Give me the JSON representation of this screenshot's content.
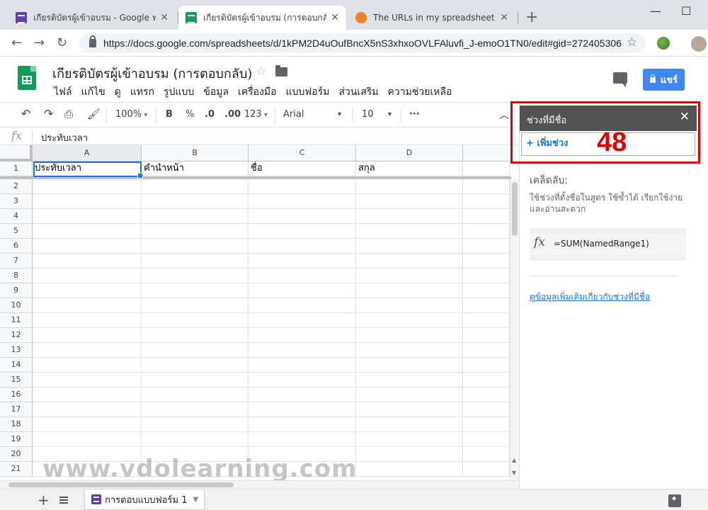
{
  "browser": {
    "tabs": [
      {
        "label": "เกียรติบัตรผู้เข้าอบรม - Google ฟอร์ม",
        "icon": "google-forms-icon",
        "active": false
      },
      {
        "label": "เกียรติบัตรผู้เข้าอบรม (การตอบกลับ) -",
        "icon": "google-sheets-icon",
        "active": true
      },
      {
        "label": "The URLs in my spreadsheet resp",
        "icon": "stackoverflow-icon",
        "active": false
      }
    ],
    "url": "https://docs.google.com/spreadsheets/d/1kPM2D4uOufBncX5nS3xhxoOVLFAluvfi_J-emoO1TN0/edit#gid=272405306"
  },
  "doc": {
    "title": "เกียรติบัตรผู้เข้าอบรม (การตอบกลับ)",
    "menu": [
      "ไฟล์",
      "แก้ไข",
      "ดู",
      "แทรก",
      "รูปแบบ",
      "ข้อมูล",
      "เครื่องมือ",
      "แบบฟอร์ม",
      "ส่วนเสริม",
      "ความช่วยเหลือ"
    ],
    "share_label": "แชร์"
  },
  "toolbar": {
    "zoom": "100%",
    "bold": "B",
    "percent": "%",
    "decrease_decimal": ".0",
    "increase_decimal": ".00",
    "number_format": "123",
    "font": "Arial",
    "font_size": "10",
    "more": "···"
  },
  "formula_bar": {
    "fx": "fx",
    "content": "ประทับเวลา"
  },
  "grid": {
    "columns": [
      "A",
      "B",
      "C",
      "D"
    ],
    "header_row": [
      "ประทับเวลา",
      "คำนำหน้า",
      "ชื่อ",
      "สกุล"
    ],
    "row_numbers": [
      "1",
      "2",
      "3",
      "4",
      "5",
      "6",
      "7",
      "8",
      "9",
      "10",
      "11",
      "12",
      "13",
      "14",
      "15",
      "16",
      "17",
      "18",
      "19",
      "20",
      "21"
    ]
  },
  "side_panel": {
    "title": "ช่วงที่มีชื่อ",
    "add_range": "+ เพิ่มช่วง",
    "tips_heading": "เคล็ดลับ:",
    "tips_text": "ใช้ช่วงที่ตั้งชื่อในสูตร ใช้ซ้ำได้ เรียกใช้ง่าย และอ่านสะดวก",
    "example_fx": "fx",
    "example_formula": "=SUM(NamedRange1)",
    "learn_more": "ดูข้อมูลเพิ่มเติมเกี่ยวกับช่วงที่มีชื่อ"
  },
  "annotation": {
    "number": "48",
    "color": "#e00000"
  },
  "watermark": "www.vdolearning.com",
  "sheet_tabs": [
    {
      "label": "การตอบแบบฟอร์ม 1"
    }
  ]
}
